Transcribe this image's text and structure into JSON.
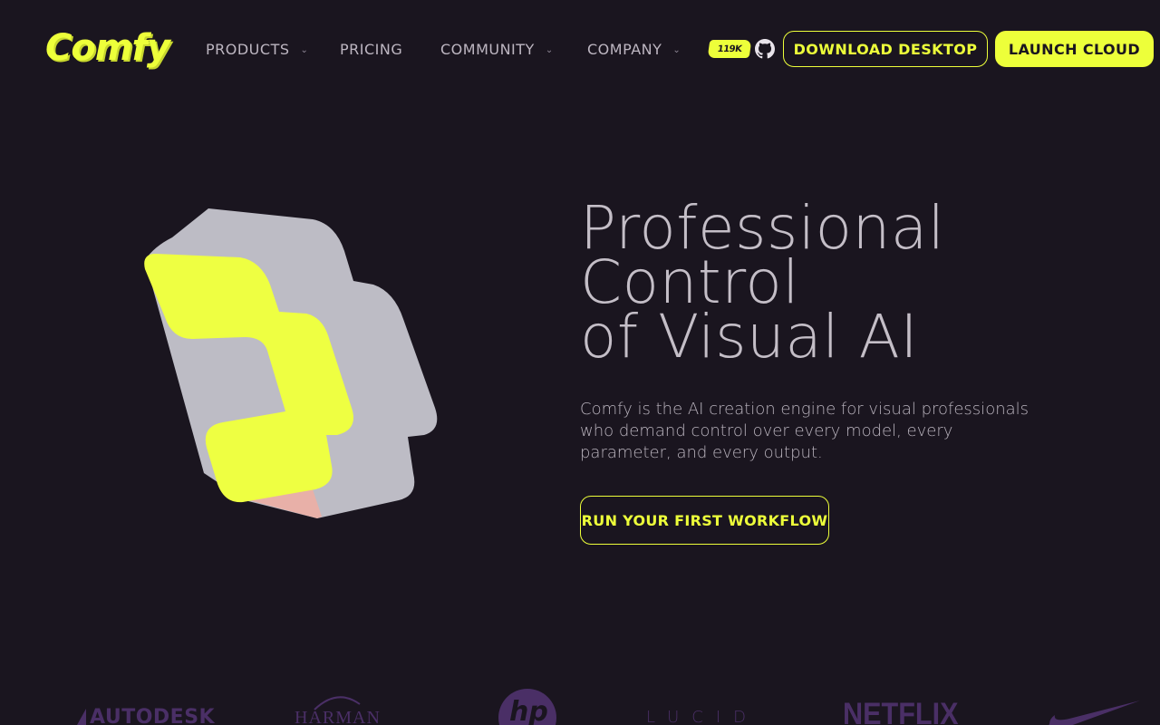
{
  "nav": {
    "logo": "Comfy",
    "items": [
      {
        "label": "PRODUCTS",
        "has_menu": true
      },
      {
        "label": "PRICING",
        "has_menu": false
      },
      {
        "label": "COMMUNITY",
        "has_menu": true
      },
      {
        "label": "COMPANY",
        "has_menu": true
      }
    ],
    "github_stars": "119K",
    "download_label": "DOWNLOAD DESKTOP",
    "launch_label": "LAUNCH CLOUD"
  },
  "hero": {
    "title_lines": [
      "Professional",
      "Control",
      "of Visual AI"
    ],
    "subtitle": "Comfy is the AI creation engine for visual professionals who demand control over every model, every parameter, and every output.",
    "cta_label": "RUN YOUR FIRST WORKFLOW"
  },
  "logos": [
    "AUTODESK",
    "HARMAN",
    "hp",
    "LUCID",
    "NETFLIX",
    "nike-swoosh-icon"
  ],
  "colors": {
    "background": "#1a151f",
    "accent": "#edff3a",
    "text": "#c4bec7",
    "logo_tint": "#4a2f66"
  }
}
